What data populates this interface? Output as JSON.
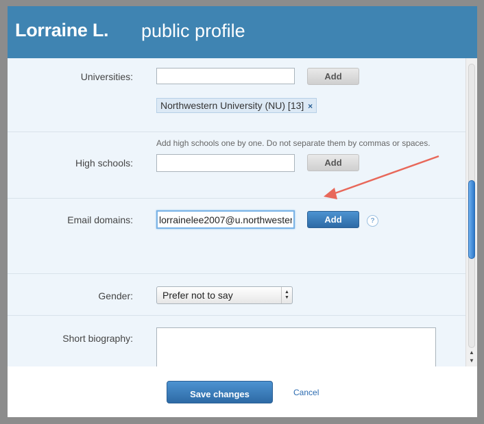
{
  "dialog": {
    "user_name": "Lorraine L.",
    "title": "public profile"
  },
  "universities": {
    "label": "Universities:",
    "input_value": "",
    "add_label": "Add",
    "tags": [
      {
        "text": "Northwestern University (NU) [13]",
        "remove": "×"
      }
    ]
  },
  "high_schools": {
    "hint": "Add high schools one by one. Do not separate them by commas or spaces.",
    "label": "High schools:",
    "input_value": "",
    "add_label": "Add"
  },
  "email_domains": {
    "label": "Email domains:",
    "input_value": "lorrainelee2007@u.northwester",
    "add_label": "Add",
    "help_icon": "?"
  },
  "gender": {
    "label": "Gender:",
    "selected": "Prefer not to say"
  },
  "biography": {
    "label": "Short biography:",
    "value": ""
  },
  "footer": {
    "save_label": "Save changes",
    "cancel_label": "Cancel"
  },
  "annotation": {
    "arrow_color": "#e8685a"
  },
  "colors": {
    "header_bg": "#3f84b2",
    "content_bg": "#eef5fb",
    "primary_button": "#2d6aa5"
  }
}
